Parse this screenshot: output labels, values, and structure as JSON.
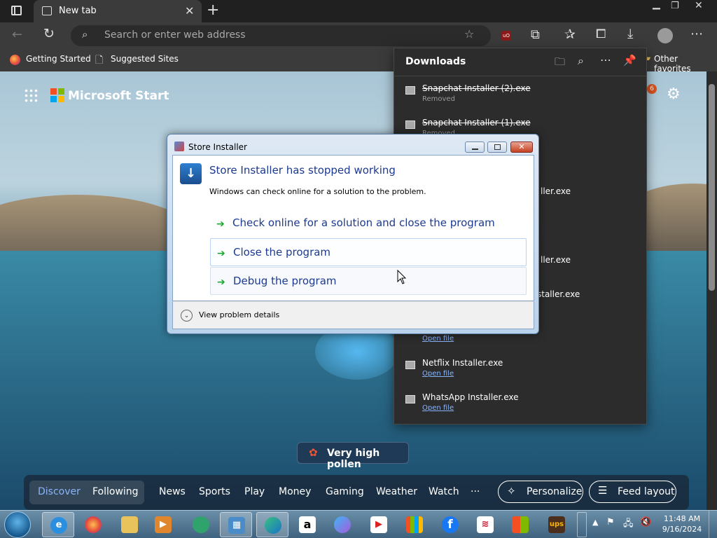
{
  "browser": {
    "tab_title": "New tab",
    "address_placeholder": "Search or enter web address",
    "favorites": [
      "Getting Started",
      "Suggested Sites"
    ],
    "other_favorites": "Other favorites"
  },
  "page": {
    "brand": "Microsoft Start",
    "notification_count": "6",
    "pollen": "Very high pollen",
    "feed_tabs": [
      "Discover",
      "Following",
      "News",
      "Sports",
      "Play",
      "Money",
      "Gaming",
      "Weather",
      "Watch",
      "···"
    ],
    "personalize": "Personalize",
    "feed_layout": "Feed layout"
  },
  "downloads": {
    "title": "Downloads",
    "items": [
      {
        "name": "Snapchat Installer (2).exe",
        "sub": "Removed"
      },
      {
        "name": "Snapchat Installer (1).exe",
        "sub": "Removed"
      },
      {
        "name": "ller.exe",
        "sub": ""
      },
      {
        "name": "ller.exe",
        "sub": ""
      },
      {
        "name": "staller.exe",
        "sub": ""
      },
      {
        "name": "",
        "sub": "Open file"
      },
      {
        "name": "Netflix Installer.exe",
        "sub": "Open file"
      },
      {
        "name": "WhatsApp Installer.exe",
        "sub": "Open file"
      }
    ]
  },
  "dialog": {
    "window_title": "Store Installer",
    "heading": "Store Installer has stopped working",
    "message": "Windows can check online for a solution to the problem.",
    "options": [
      "Check online for a solution and close the program",
      "Close the program",
      "Debug the program"
    ],
    "details": "View problem details"
  },
  "taskbar": {
    "time": "11:48 AM",
    "date": "9/16/2024"
  },
  "colors": {
    "accent": "#1c3a8f",
    "chrome": "#3b3b3b",
    "link": "#8ab4f8"
  }
}
